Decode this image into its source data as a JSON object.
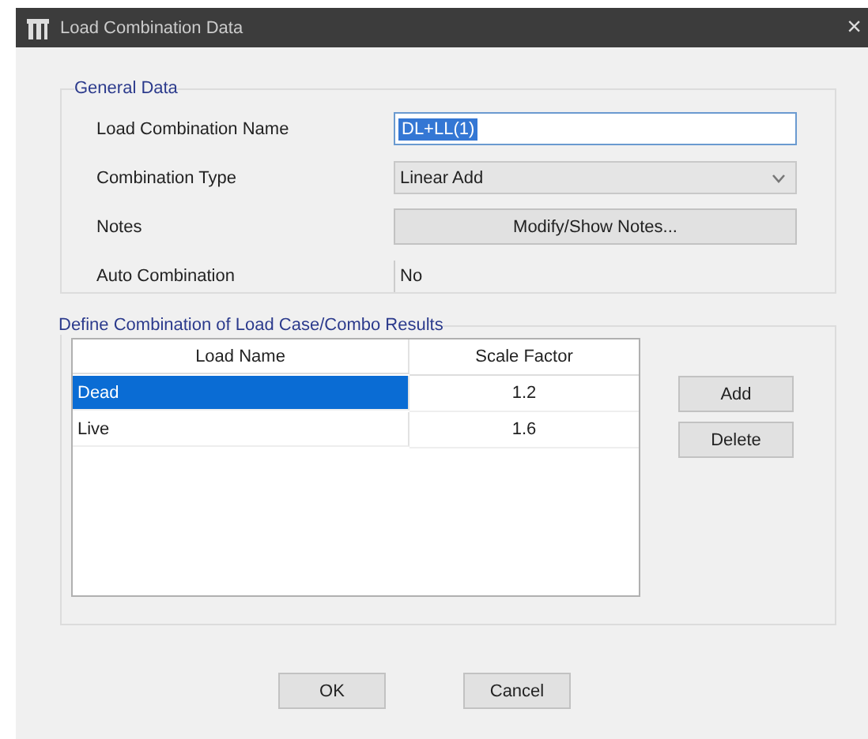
{
  "window": {
    "title": "Load Combination Data",
    "close": "×"
  },
  "general_data": {
    "title": "General Data",
    "fields": [
      {
        "kind": "text",
        "label": "Load Combination Name",
        "value": "DL+LL(1)"
      },
      {
        "kind": "dropdown",
        "label": "Combination Type",
        "value": "Linear Add"
      },
      {
        "kind": "button",
        "label": "Notes",
        "value": "Modify/Show Notes..."
      },
      {
        "kind": "static",
        "label": "Auto Combination",
        "value": "No"
      }
    ]
  },
  "combination": {
    "title": "Define Combination of Load Case/Combo Results",
    "columns": [
      "Load Name",
      "Scale Factor"
    ],
    "rows": [
      {
        "load_name": "Dead",
        "scale_factor": "1.2",
        "selected": true
      },
      {
        "load_name": "Live",
        "scale_factor": "1.6",
        "selected": false
      }
    ],
    "buttons": [
      "Add",
      "Delete"
    ]
  },
  "buttons": [
    "OK",
    "Cancel"
  ]
}
